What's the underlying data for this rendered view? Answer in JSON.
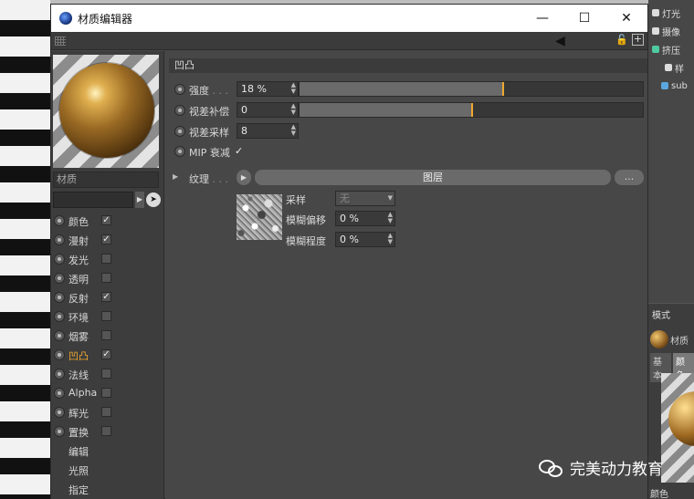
{
  "window": {
    "title": "材质编辑器",
    "minimize": "—",
    "maximize": "☐",
    "close": "✕"
  },
  "left": {
    "name_field": "材质",
    "channels": [
      {
        "label": "颜色",
        "checked": true
      },
      {
        "label": "漫射",
        "checked": true
      },
      {
        "label": "发光",
        "checked": false
      },
      {
        "label": "透明",
        "checked": false
      },
      {
        "label": "反射",
        "checked": true
      },
      {
        "label": "环境",
        "checked": false
      },
      {
        "label": "烟雾",
        "checked": false
      },
      {
        "label": "凹凸",
        "checked": true,
        "active": true
      },
      {
        "label": "法线",
        "checked": false
      },
      {
        "label": "Alpha",
        "checked": false
      },
      {
        "label": "辉光",
        "checked": false
      },
      {
        "label": "置换",
        "checked": false
      }
    ],
    "extra_items": [
      "编辑",
      "光照",
      "指定"
    ]
  },
  "content": {
    "section_title": "凹凸",
    "strength": {
      "label": "强度",
      "dots": " . . .",
      "value": "18 %",
      "fraction": 0.59
    },
    "parallax_offset": {
      "label": "视差补偿",
      "value": "0",
      "fraction": 0.5
    },
    "parallax_samples": {
      "label": "视差采样",
      "value": "8"
    },
    "mip_falloff": {
      "label": "MIP 衰减",
      "check": "✓"
    },
    "texture": {
      "label": "纹理",
      "dots": " . . .",
      "button": "图层",
      "more": "..."
    },
    "sampling": {
      "label": "采样",
      "value": "无"
    },
    "blur_offset": {
      "label": "模糊偏移",
      "value": "0 %"
    },
    "blur_scale": {
      "label": "模糊程度",
      "value": "0 %"
    }
  },
  "right_panel": {
    "items": [
      "灯光",
      "摄像",
      "挤压",
      "样",
      "sub"
    ],
    "mode": "模式",
    "material": "材质",
    "tab_basic": "基本",
    "tab_color": "颜色",
    "color_label": "颜色"
  },
  "watermark": "完美动力教育",
  "colors": {
    "accent": "#f0a830",
    "panel": "#474747"
  }
}
